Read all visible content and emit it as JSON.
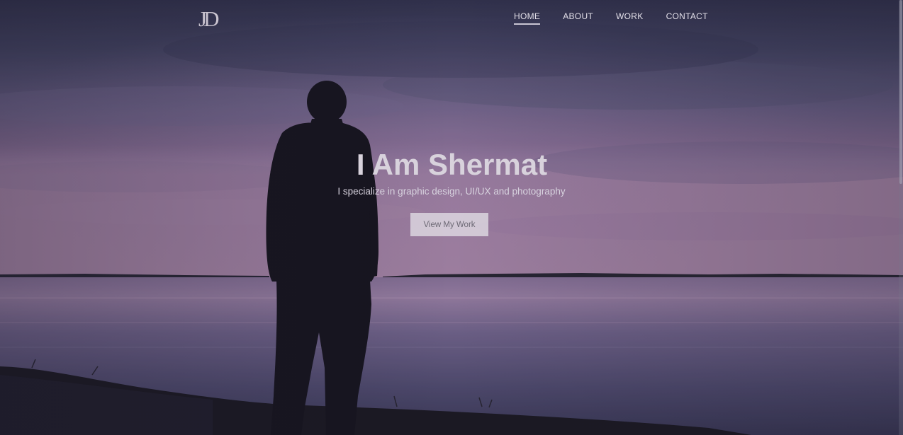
{
  "logo": {
    "text": "JD"
  },
  "nav": {
    "items": [
      {
        "label": "HOME",
        "active": true
      },
      {
        "label": "ABOUT",
        "active": false
      },
      {
        "label": "WORK",
        "active": false
      },
      {
        "label": "CONTACT",
        "active": false
      }
    ]
  },
  "hero": {
    "title": "I Am Shermat",
    "subtitle": "I specialize in graphic design, UI/UX and photography",
    "cta_label": "View My Work"
  },
  "colors": {
    "sky_top": "#3c3d5e",
    "horizon_pink": "#a682ac",
    "water": "#6a5e86",
    "silhouette": "#15131c"
  },
  "icons": {
    "background": "lake-silhouette-photo"
  }
}
